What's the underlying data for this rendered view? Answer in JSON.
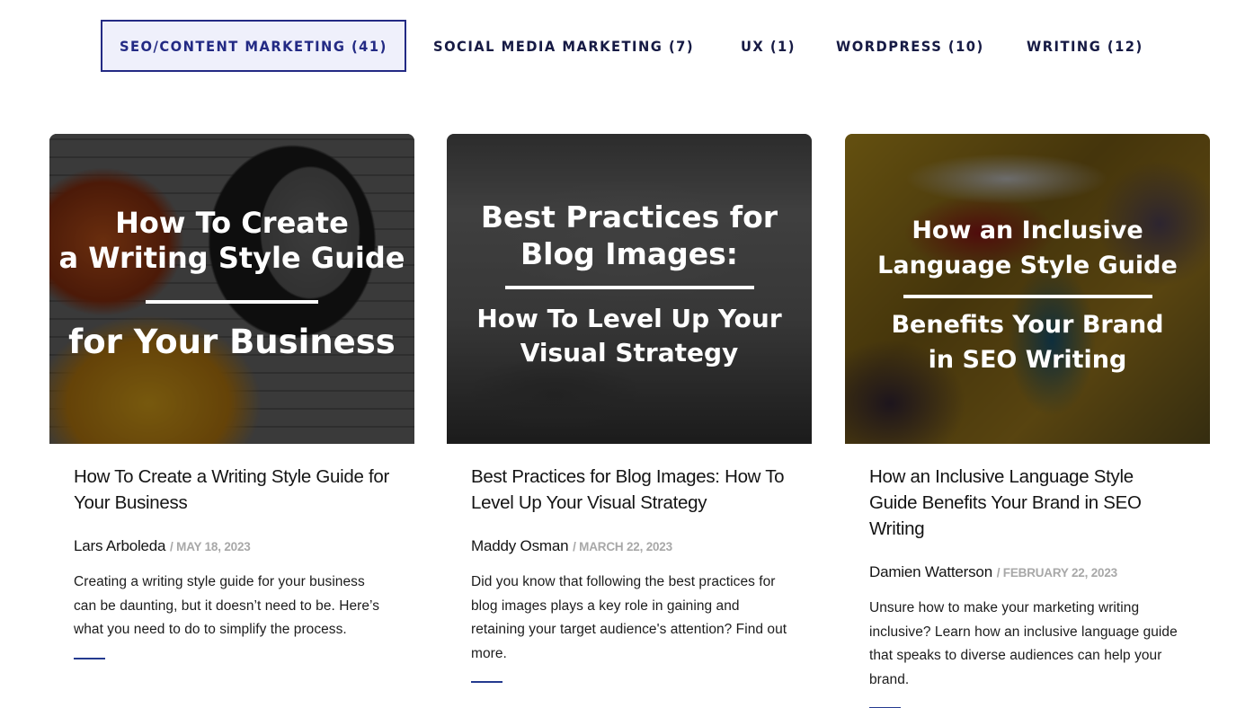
{
  "tabs": [
    {
      "label": "SEO/CONTENT MARKETING (41)",
      "active": true
    },
    {
      "label": "SOCIAL MEDIA MARKETING (7)",
      "active": false
    },
    {
      "label": "UX (1)",
      "active": false
    },
    {
      "label": "WORDPRESS (10)",
      "active": false
    },
    {
      "label": "WRITING (12)",
      "active": false
    }
  ],
  "colors": {
    "accent": "#232a84",
    "active_tab_bg": "#eff0fb",
    "accent_bar": "#243a8f",
    "date": "#a8a8a8"
  },
  "posts": [
    {
      "image_text": {
        "top_lines": [
          "How To Create",
          "a Writing Style Guide"
        ],
        "bottom_lines": [
          "for Your Business"
        ]
      },
      "title": "How To Create a Writing Style Guide for Your Business",
      "author": "Lars Arboleda",
      "date": "/ MAY 18, 2023",
      "excerpt": "Creating a writing style guide for your business can be daunting, but it doesn’t need to be. Here’s what you need to do to simplify the process."
    },
    {
      "image_text": {
        "top_lines": [
          "Best Practices for",
          "Blog Images:"
        ],
        "bottom_lines": [
          "How To Level Up Your",
          "Visual Strategy"
        ]
      },
      "title": "Best Practices for Blog Images: How To Level Up Your Visual Strategy",
      "author": "Maddy Osman",
      "date": "/ MARCH 22, 2023",
      "excerpt": "Did you know that following the best practices for blog images plays a key role in gaining and retaining your target audience's attention? Find out more."
    },
    {
      "image_text": {
        "top_lines": [
          "How an Inclusive",
          "Language Style Guide"
        ],
        "bottom_lines": [
          "Benefits Your Brand",
          "in SEO Writing"
        ]
      },
      "title": "How an Inclusive Language Style Guide Benefits Your Brand in SEO Writing",
      "author": "Damien Watterson",
      "date": "/ FEBRUARY 22, 2023",
      "excerpt": "Unsure how to make your marketing writing inclusive? Learn how an inclusive language guide that speaks to diverse audiences can help your brand."
    }
  ]
}
